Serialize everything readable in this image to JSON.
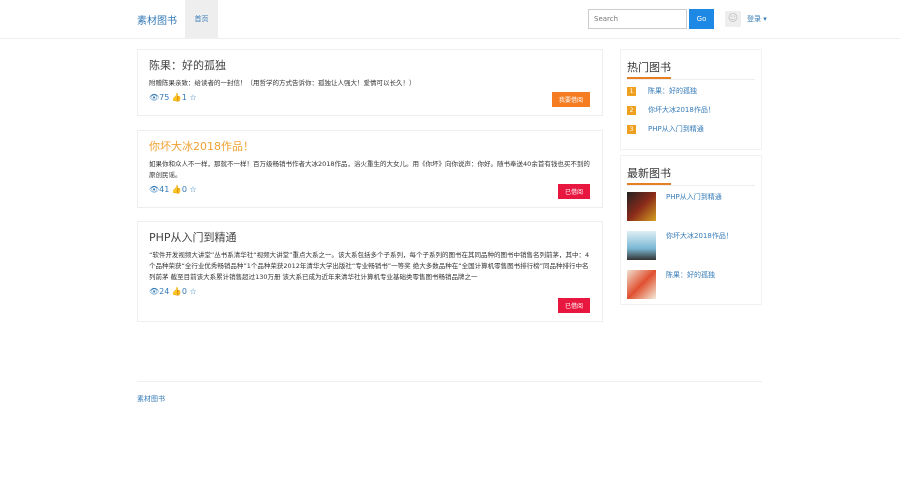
{
  "nav": {
    "brand": "素材图书",
    "home": "首页",
    "search_placeholder": "Search",
    "go": "Go",
    "login": "登录 ▾"
  },
  "books": [
    {
      "title": "陈果：好的孤独",
      "desc": "附赠陈果亲致：给读者的一封信！（用哲学的方式告诉你：孤独让人强大！爱情可以长久！）",
      "views": "75",
      "likes": "1",
      "button": "我要借阅",
      "title_color": "#444",
      "button_color": "#f57c20"
    },
    {
      "title": "你坏大冰2018作品！",
      "desc": "如果你和众人不一样，那就不一样！百万级畅销书作者大冰2018作品，浴火重生的大女儿。用《你坏》向你说声：你好。随书奉送40余首有钱也买不到的原创民谣。",
      "views": "41",
      "likes": "0",
      "button": "已借阅",
      "title_color": "#f0a030",
      "button_color": "#e8173f"
    },
    {
      "title": "PHP从入门到精通",
      "desc": "“软件开发视频大讲堂”丛书系清华社“视频大讲堂”重点大系之一。该大系包括多个子系列，每个子系列的图书在其同品种的图书中销售名列前茅，其中：4个品种荣获“全行业优秀畅销品种”1个品种荣获2012年清华大学出版社“专业畅销书”一等奖 绝大多数品种在“全国计算机零售图书排行榜”同品种排行中名列前茅 截至目前该大系累计销售超过130万册 该大系已成为近年来清华社计算机专业基础类零售图书畅销品牌之一",
      "views": "24",
      "likes": "0",
      "button": "已借阅",
      "title_color": "#444",
      "button_color": "#e8173f"
    }
  ],
  "hot": {
    "title": "热门图书",
    "items": [
      {
        "rank": "1",
        "label": "陈果：好的孤独"
      },
      {
        "rank": "2",
        "label": "你坏大冰2018作品！"
      },
      {
        "rank": "3",
        "label": "PHP从入门到精通"
      }
    ]
  },
  "latest": {
    "title": "最新图书",
    "items": [
      {
        "label": "PHP从入门到精通"
      },
      {
        "label": "你坏大冰2018作品！"
      },
      {
        "label": "陈果：好的孤独"
      }
    ]
  },
  "footer": {
    "text": "素材图书"
  }
}
